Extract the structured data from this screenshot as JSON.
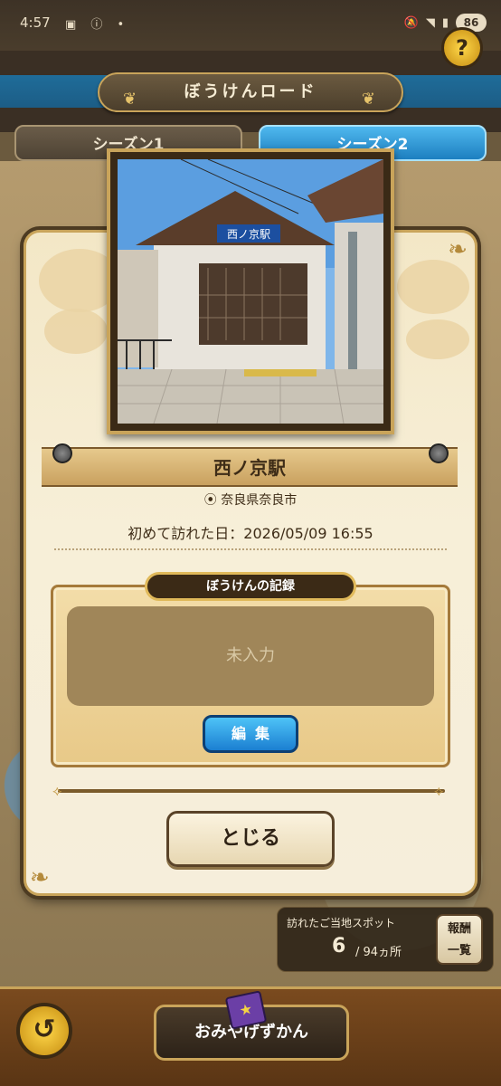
{
  "status": {
    "time": "4:57",
    "left_icons": "▣ ⓘ •",
    "battery": "86"
  },
  "header": {
    "title": "ぼうけんロード",
    "help": "?"
  },
  "tabs": [
    "シーズン1",
    "シーズン2"
  ],
  "spot": {
    "name": "西ノ京駅",
    "location": "奈良県奈良市",
    "visited_label": "初めて訪れた日：2026/05/09 16:55"
  },
  "record": {
    "label": "ぼうけんの記録",
    "placeholder": "未入力",
    "edit_button": "編集"
  },
  "close_button": "とじる",
  "spots_counter": {
    "label": "訪れたご当地スポット",
    "count": "6",
    "total": "/ 94ヵ所"
  },
  "reward_button": [
    "報酬",
    "一覧"
  ],
  "bottom": {
    "book_button": "おみやげずかん",
    "back_icon": "↺"
  },
  "colors": {
    "accent_blue": "#1d7fc0",
    "gold": "#c9a45a",
    "brown": "#3b2a16"
  }
}
